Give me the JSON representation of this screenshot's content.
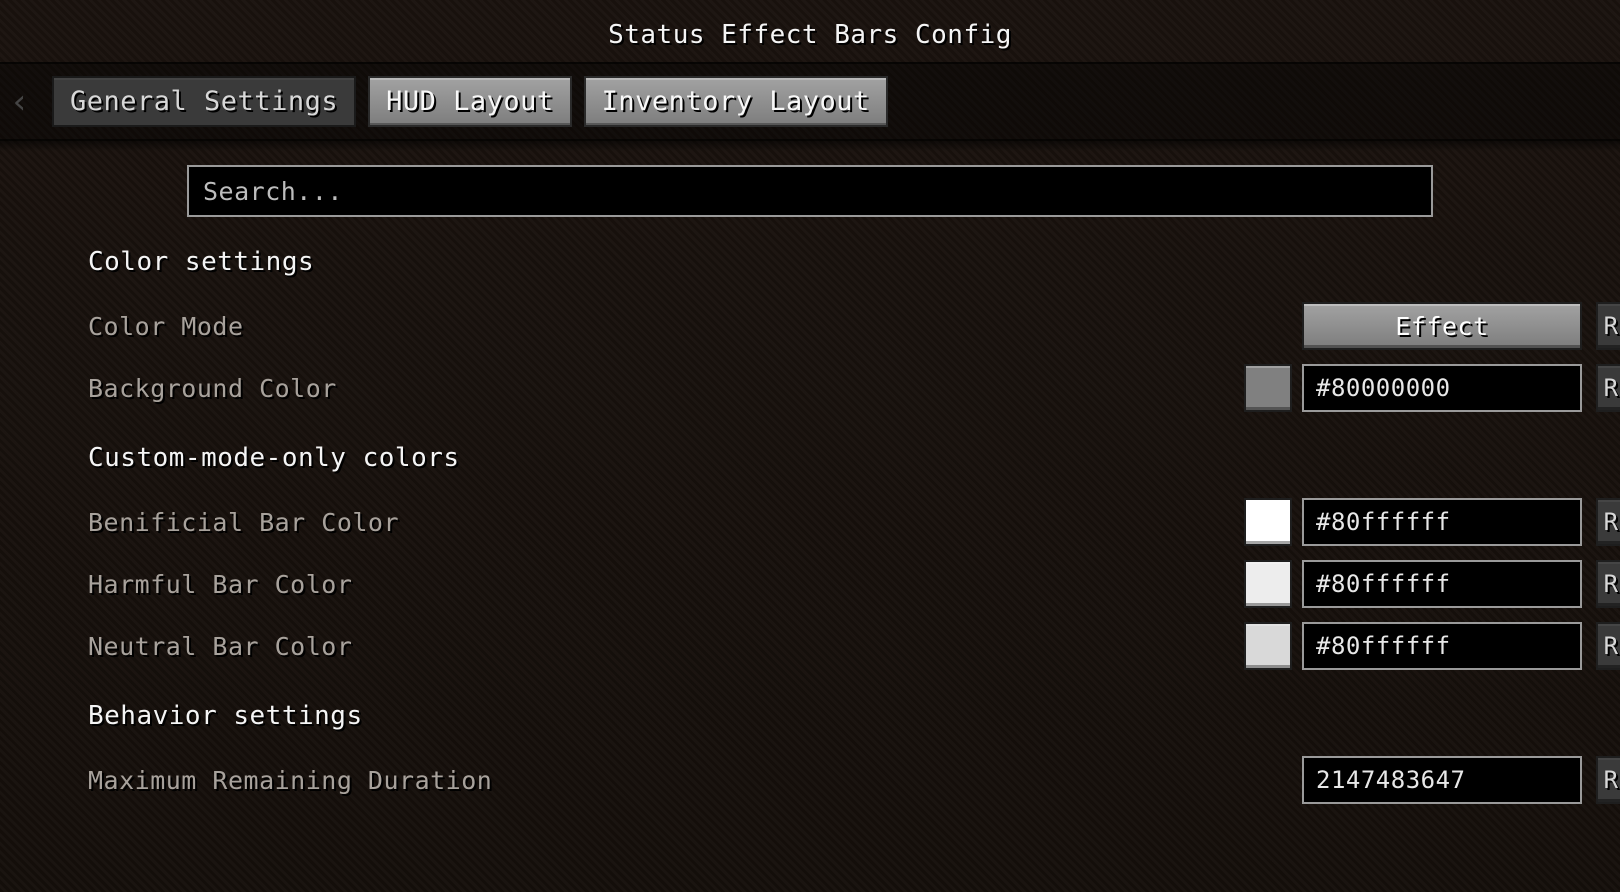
{
  "header": {
    "title": "Status Effect Bars Config"
  },
  "tabs": {
    "back_icon": "‹",
    "items": [
      {
        "label": "General Settings",
        "active": true
      },
      {
        "label": "HUD Layout",
        "active": false
      },
      {
        "label": "Inventory Layout",
        "active": false
      }
    ]
  },
  "search": {
    "placeholder": "Search...",
    "value": ""
  },
  "common": {
    "reset_label": "Reset"
  },
  "sections": {
    "color_settings": {
      "heading": "Color settings",
      "color_mode": {
        "label": "Color Mode",
        "value": "Effect"
      },
      "background_color": {
        "label": "Background Color",
        "value": "#80000000",
        "swatch": "#808080"
      }
    },
    "custom_mode": {
      "heading": "Custom-mode-only colors",
      "beneficial": {
        "label": "Benificial Bar Color",
        "value": "#80ffffff",
        "swatch": "#ffffff"
      },
      "harmful": {
        "label": "Harmful Bar Color",
        "value": "#80ffffff",
        "swatch": "#ededed"
      },
      "neutral": {
        "label": "Neutral Bar Color",
        "value": "#80ffffff",
        "swatch": "#d9d9d9"
      }
    },
    "behavior": {
      "heading": "Behavior settings",
      "max_remaining": {
        "label": "Maximum Remaining Duration",
        "value": "2147483647"
      }
    }
  }
}
